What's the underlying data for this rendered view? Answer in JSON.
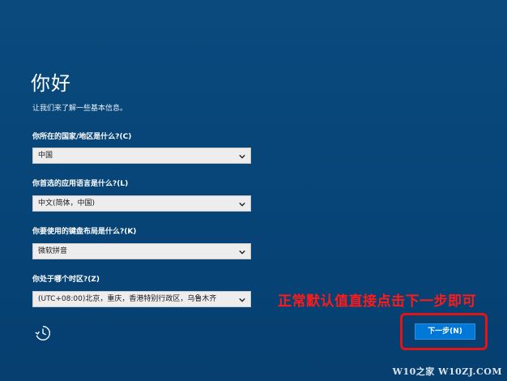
{
  "page": {
    "title": "你好",
    "subtitle": "让我们来了解一些基本信息。"
  },
  "fields": [
    {
      "label": "你所在的国家/地区是什么?(C)",
      "value": "中国"
    },
    {
      "label": "你首选的应用语言是什么?(L)",
      "value": "中文(简体，中国)"
    },
    {
      "label": "你要使用的键盘布局是什么?(K)",
      "value": "微软拼音"
    },
    {
      "label": "你处于哪个时区?(Z)",
      "value": "(UTC+08:00)北京，重庆，香港特别行政区，乌鲁木齐"
    }
  ],
  "icons": {
    "accessibility": "ease-of-access-icon",
    "dropdown": "chevron-down-icon"
  },
  "next_button": {
    "label": "下一步(N)"
  },
  "annotation": {
    "text": "正常默认值直接点击下一步即可",
    "color": "#ff1a1a"
  },
  "watermark": {
    "text": "W10之家 W10ZJ.COM"
  },
  "colors": {
    "background": "#064273",
    "button": "#0078d7",
    "highlight": "#e21414"
  }
}
